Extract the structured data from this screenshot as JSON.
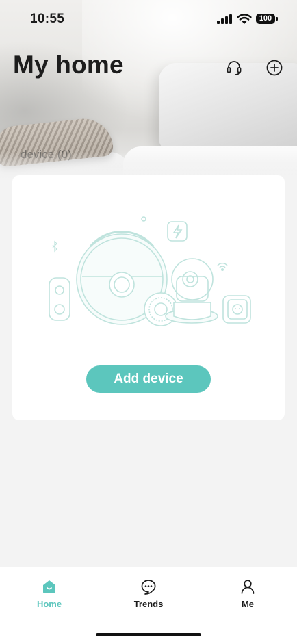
{
  "status_bar": {
    "time": "10:55",
    "battery": "100"
  },
  "header": {
    "title": "My home",
    "support_icon": "headset-icon",
    "add_icon": "plus-circle-icon"
  },
  "background_partial_text": "device (0)",
  "card": {
    "add_device_label": "Add device",
    "illustration": "smart-devices-illustration"
  },
  "tabs": [
    {
      "label": "Home",
      "icon": "home-icon",
      "active": true
    },
    {
      "label": "Trends",
      "icon": "chat-bubble-icon",
      "active": false
    },
    {
      "label": "Me",
      "icon": "person-icon",
      "active": false
    }
  ],
  "colors": {
    "accent": "#5cc6bd",
    "background": "#f3f3f3",
    "card": "#ffffff",
    "line_art": "#cfe9e5"
  }
}
